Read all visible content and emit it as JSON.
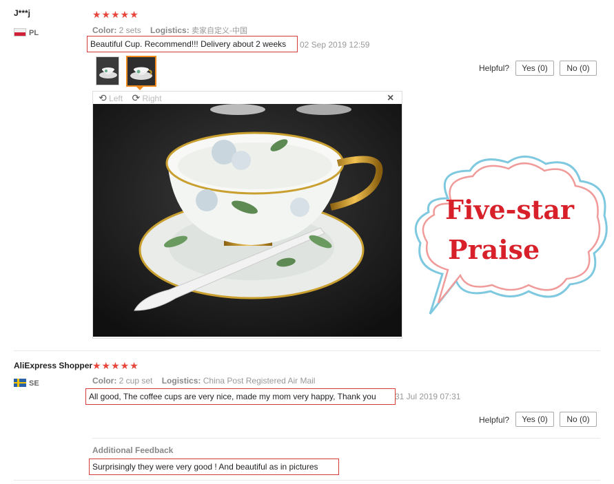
{
  "review1": {
    "user": "J***j",
    "country": "PL",
    "stars": "★★★★★",
    "color_label": "Color:",
    "color_value": "2 sets",
    "logistics_label": "Logistics:",
    "logistics_value": "卖家自定义-中国",
    "text": "Beautiful Cup. Recommend!!! Delivery about 2 weeks",
    "date": "02 Sep 2019 12:59",
    "helpful_label": "Helpful?",
    "yes_label": "Yes (0)",
    "no_label": "No (0)"
  },
  "viewer": {
    "rotate_left_label": "Left",
    "rotate_right_label": "Right",
    "close_label": "×"
  },
  "cloud": {
    "line1": "Five-star",
    "line2": "Praise"
  },
  "review2": {
    "user": "AliExpress Shopper",
    "country": "SE",
    "stars": "★★★★★",
    "color_label": "Color:",
    "color_value": "2 cup set",
    "logistics_label": "Logistics:",
    "logistics_value": "China Post Registered Air Mail",
    "text": "All good, The coffee cups are very nice, made my mom very happy, Thank you",
    "date": "31 Jul 2019 07:31",
    "helpful_label": "Helpful?",
    "yes_label": "Yes (0)",
    "no_label": "No (0)",
    "additional_title": "Additional Feedback",
    "additional_text": "Surprisingly they were very good ! And beautiful as in pictures"
  },
  "colors": {
    "star": "#e8463c",
    "highlight_border": "#d83a3a",
    "thumb_active": "#f08a1c",
    "cloud_text": "#d8202a",
    "cloud_outer": "#7ec8e0",
    "cloud_inner": "#f09a9a"
  }
}
